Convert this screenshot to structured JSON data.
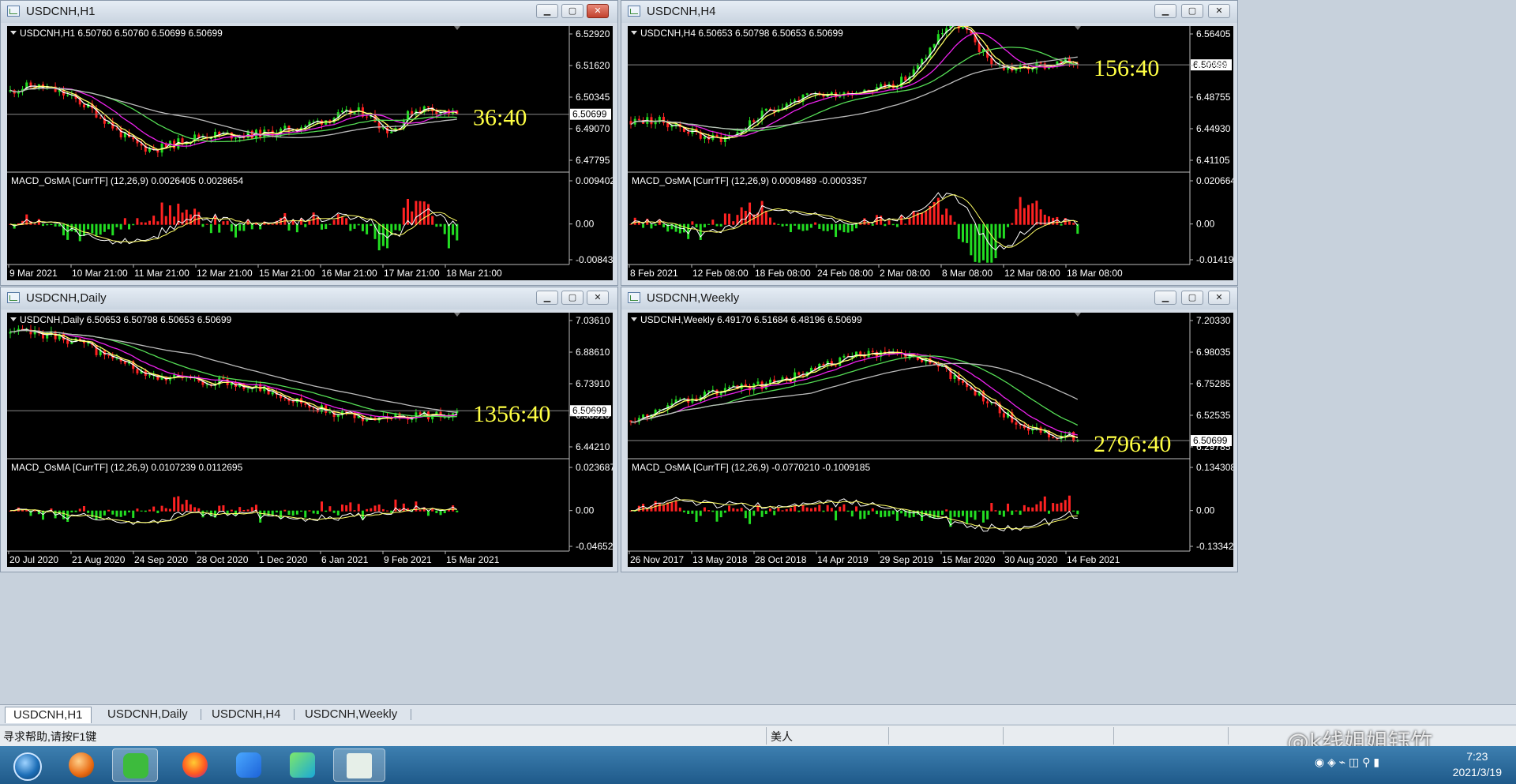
{
  "windows": [
    {
      "id": "h1",
      "title": "USDCNH,H1",
      "active": true,
      "price_header": "USDCNH,H1  6.50760 6.50760 6.50699 6.50699",
      "price_axis": [
        "6.52920",
        "6.51620",
        "6.50345",
        "6.49070",
        "6.47795"
      ],
      "current_price": "6.50699",
      "countdown": "36:40",
      "macd_header": "MACD_OsMA [CurrTF] (12,26,9) 0.0026405 0.0028654",
      "macd_axis": [
        "0.009402",
        "0.00",
        "-0.008439"
      ],
      "date_axis": [
        "9 Mar 2021",
        "10 Mar 21:00",
        "11 Mar 21:00",
        "12 Mar 21:00",
        "15 Mar 21:00",
        "16 Mar 21:00",
        "17 Mar 21:00",
        "18 Mar 21:00"
      ],
      "trend": "sideways"
    },
    {
      "id": "h4",
      "title": "USDCNH,H4",
      "active": false,
      "price_header": "USDCNH,H4  6.50653 6.50798 6.50653 6.50699",
      "price_axis": [
        "6.56405",
        "6.52580",
        "6.48755",
        "6.44930",
        "6.41105"
      ],
      "current_price": "6.50699",
      "countdown": "156:40",
      "macd_header": "MACD_OsMA [CurrTF] (12,26,9) 0.0008489 -0.0003357",
      "macd_axis": [
        "0.0206644",
        "0.00",
        "-0.0141923"
      ],
      "date_axis": [
        "8 Feb 2021",
        "12 Feb 08:00",
        "18 Feb 08:00",
        "24 Feb 08:00",
        "2 Mar 08:00",
        "8 Mar 08:00",
        "12 Mar 08:00",
        "18 Mar 08:00"
      ],
      "trend": "up"
    },
    {
      "id": "daily",
      "title": "USDCNH,Daily",
      "active": false,
      "price_header": "USDCNH,Daily  6.50653 6.50798 6.50653 6.50699",
      "price_axis": [
        "7.03610",
        "6.88610",
        "6.73910",
        "6.58910",
        "6.44210"
      ],
      "current_price": "6.50699",
      "countdown": "1356:40",
      "macd_header": "MACD_OsMA [CurrTF] (12,26,9) 0.0107239 0.0112695",
      "macd_axis": [
        "0.023687",
        "0.00",
        "-0.046526"
      ],
      "date_axis": [
        "20 Jul 2020",
        "21 Aug 2020",
        "24 Sep 2020",
        "28 Oct 2020",
        "1 Dec 2020",
        "6 Jan 2021",
        "9 Feb 2021",
        "15 Mar 2021"
      ],
      "trend": "down"
    },
    {
      "id": "weekly",
      "title": "USDCNH,Weekly",
      "active": false,
      "price_header": "USDCNH,Weekly  6.49170 6.51684 6.48196 6.50699",
      "price_axis": [
        "7.20330",
        "6.98035",
        "6.75285",
        "6.52535",
        "6.29785"
      ],
      "current_price": "6.50699",
      "countdown": "2796:40",
      "macd_header": "MACD_OsMA [CurrTF] (12,26,9) -0.0770210 -0.1009185",
      "macd_axis": [
        "0.1343086",
        "0.00",
        "-0.1334299"
      ],
      "date_axis": [
        "26 Nov 2017",
        "13 May 2018",
        "28 Oct 2018",
        "14 Apr 2019",
        "29 Sep 2019",
        "15 Mar 2020",
        "30 Aug 2020",
        "14 Feb 2021"
      ],
      "trend": "hump"
    }
  ],
  "tabs": [
    {
      "label": "USDCNH,H1",
      "active": true
    },
    {
      "label": "USDCNH,Daily",
      "active": false
    },
    {
      "label": "USDCNH,H4",
      "active": false
    },
    {
      "label": "USDCNH,Weekly",
      "active": false
    }
  ],
  "status": {
    "help": "寻求帮助,请按F1键",
    "profile": "美人"
  },
  "watermark": "@k线姐姐钰竹",
  "taskbar": {
    "time": "7:23",
    "date": "2021/3/19",
    "items": [
      "start-orb",
      "media-app",
      "wechat",
      "firefox",
      "feishu",
      "player",
      "app-thumbnail"
    ]
  },
  "colors": {
    "bull": "#22dd22",
    "bear": "#ff2222",
    "ma_yellow": "#ffff66",
    "ma_white": "#ffffff",
    "ma_magenta": "#ee22ee",
    "ma_green": "#55dd55",
    "ma_grey": "#bbbbbb",
    "countdown": "#ffff44"
  }
}
